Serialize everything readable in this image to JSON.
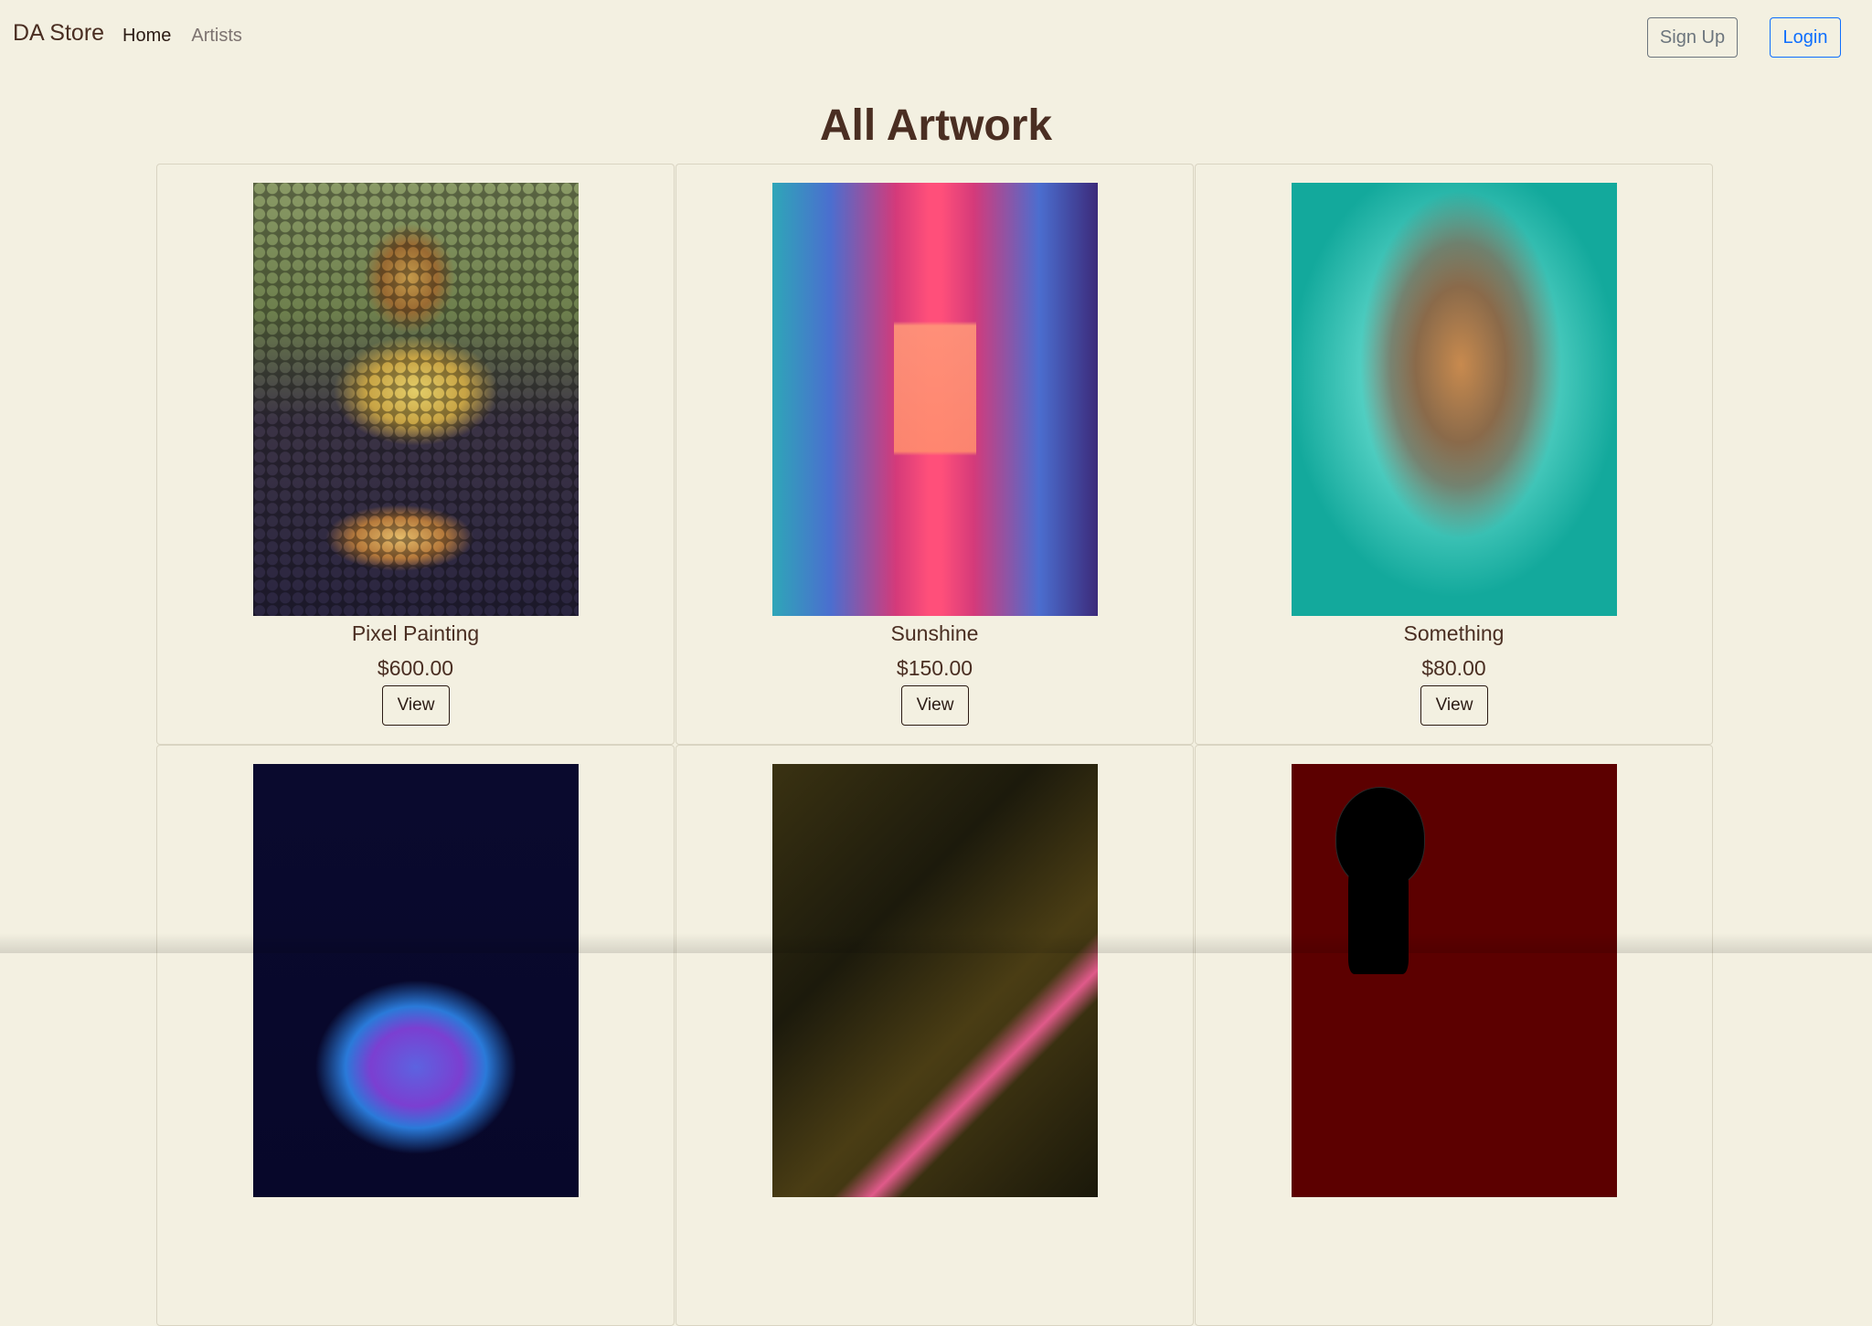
{
  "navbar": {
    "brand": "DA Store",
    "links": [
      {
        "label": "Home",
        "active": true
      },
      {
        "label": "Artists",
        "active": false
      }
    ],
    "signup_label": "Sign Up",
    "login_label": "Login"
  },
  "page": {
    "title": "All Artwork"
  },
  "artworks": [
    {
      "title": "Pixel Painting",
      "price": "$600.00",
      "button": "View",
      "image": "pixel-mona-lisa"
    },
    {
      "title": "Sunshine",
      "price": "$150.00",
      "button": "View",
      "image": "neon-corridor"
    },
    {
      "title": "Something",
      "price": "$80.00",
      "button": "View",
      "image": "sculpture-face"
    },
    {
      "title": "",
      "price": "",
      "button": "",
      "image": "neon-bust"
    },
    {
      "title": "",
      "price": "",
      "button": "",
      "image": "light-streak"
    },
    {
      "title": "",
      "price": "",
      "button": "",
      "image": "red-silhouette"
    }
  ],
  "colors": {
    "background": "#f3f0e1",
    "text": "#4a2e22",
    "login_accent": "#0d6efd",
    "signup_accent": "#6c757d"
  }
}
